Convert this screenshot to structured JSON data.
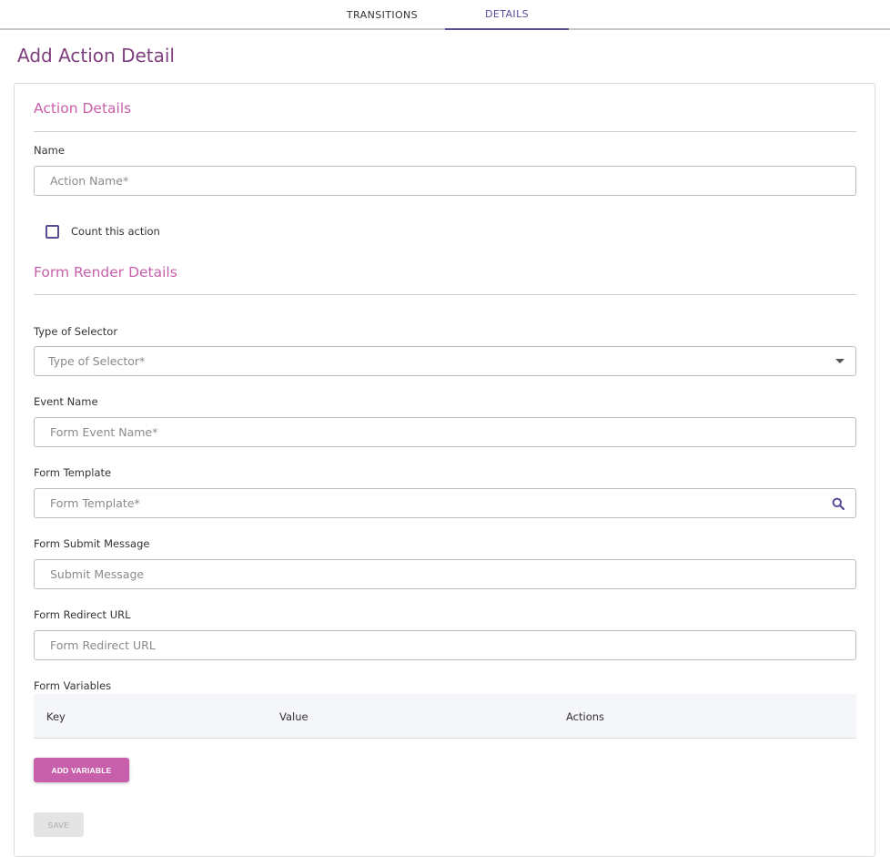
{
  "tabs": [
    {
      "label": "TRANSITIONS",
      "active": false
    },
    {
      "label": "DETAILS",
      "active": true
    }
  ],
  "page_title": "Add Action Detail",
  "action_details": {
    "title": "Action Details",
    "name_label": "Name",
    "name_placeholder": "Action Name*",
    "count_label": "Count this action",
    "count_checked": false
  },
  "form_render": {
    "title": "Form Render Details",
    "selector_label": "Type of Selector",
    "selector_placeholder": "Type of Selector*",
    "event_label": "Event Name",
    "event_placeholder": "Form Event Name*",
    "template_label": "Form Template",
    "template_placeholder": "Form Template*",
    "submit_label": "Form Submit Message",
    "submit_placeholder": "Submit Message",
    "redirect_label": "Form Redirect URL",
    "redirect_placeholder": "Form Redirect URL",
    "variables_label": "Form Variables",
    "columns": {
      "key": "Key",
      "value": "Value",
      "actions": "Actions"
    }
  },
  "buttons": {
    "add_variable": "ADD VARIABLE",
    "save": "SAVE"
  },
  "colors": {
    "accent": "#5a4a96",
    "section_title": "#c85fab",
    "page_title": "#7e3f7e",
    "button": "#c85fab"
  },
  "icons": {
    "selector_trailing": "dropdown-arrow-icon",
    "template_trailing": "search-icon"
  }
}
